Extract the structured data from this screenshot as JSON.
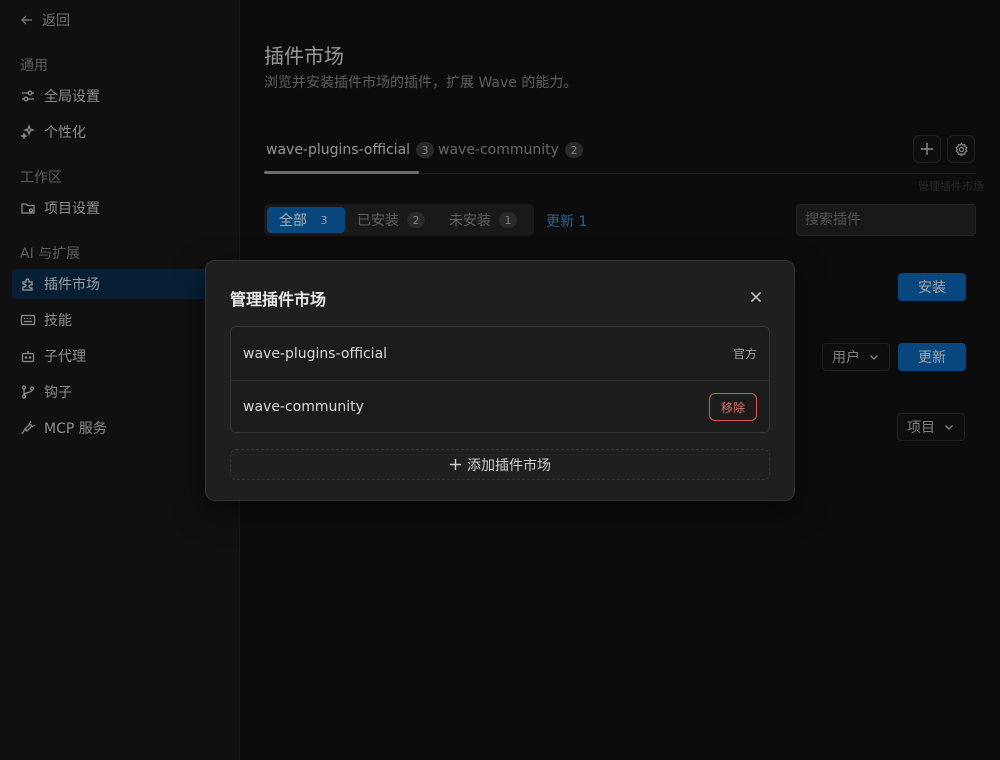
{
  "sidebar": {
    "back_label": "返回",
    "sections": [
      {
        "label": "通用"
      },
      {
        "label": "工作区"
      },
      {
        "label": "AI 与扩展"
      }
    ],
    "items": [
      {
        "label": "全局设置",
        "icon": "sliders-icon"
      },
      {
        "label": "个性化",
        "icon": "sparkles-icon"
      },
      {
        "label": "项目设置",
        "icon": "folder-gear-icon"
      },
      {
        "label": "插件市场",
        "icon": "puzzle-icon",
        "active": true
      },
      {
        "label": "技能",
        "icon": "keyboard-icon"
      },
      {
        "label": "子代理",
        "icon": "bot-icon"
      },
      {
        "label": "钩子",
        "icon": "git-branch-icon"
      },
      {
        "label": "MCP 服务",
        "icon": "plug-icon"
      }
    ]
  },
  "main": {
    "title": "插件市场",
    "subtitle": "浏览并安装插件市场的插件，扩展 Wave 的能力。",
    "tabs": [
      {
        "label": "wave-plugins-official",
        "count": "3",
        "active": true
      },
      {
        "label": "wave-community",
        "count": "2"
      }
    ],
    "tooltip_text": "管理插件市场",
    "filters": [
      {
        "label": "全部",
        "count": "3",
        "active": true
      },
      {
        "label": "已安装",
        "count": "2"
      },
      {
        "label": "未安装",
        "count": "1"
      }
    ],
    "update_link": "更新 1",
    "search_placeholder": "搜索插件",
    "row_actions": {
      "install": "安装",
      "update": "更新",
      "scope_user": "用户",
      "scope_project": "项目"
    }
  },
  "modal": {
    "title": "管理插件市场",
    "marketplaces": [
      {
        "name": "wave-plugins-official",
        "tag": "官方"
      },
      {
        "name": "wave-community",
        "action": "移除"
      }
    ],
    "add_label": "添加插件市场"
  },
  "colors": {
    "accent": "#0b69b8",
    "danger": "#e06c6c",
    "background": "#121212",
    "sidebar": "#181818",
    "active_nav": "#0b2f4e"
  }
}
